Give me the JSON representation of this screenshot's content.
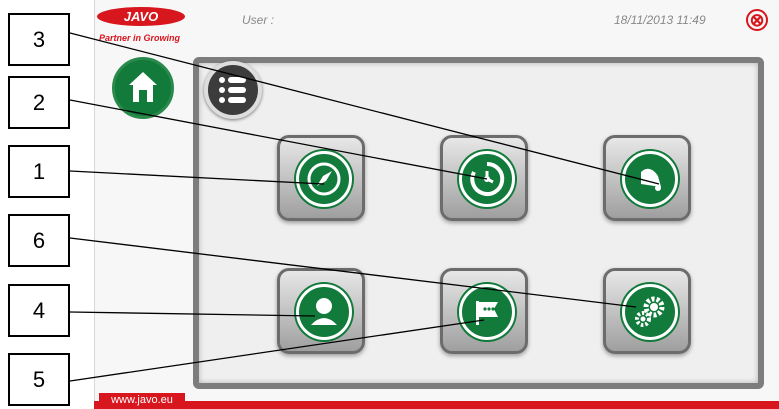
{
  "header": {
    "logo_text": "JAVO",
    "tagline": "Partner in Growing",
    "user_label": "User :",
    "datetime": "18/11/2013  11:49",
    "close_symbol": "⊗"
  },
  "footer": {
    "url": "www.javo.eu"
  },
  "callouts": [
    "3",
    "2",
    "1",
    "6",
    "4",
    "5"
  ],
  "icons": {
    "home": "home-icon",
    "menu": "list-menu-icon",
    "tiles": [
      "compass-icon",
      "timer-icon",
      "alarm-bell-icon",
      "user-icon",
      "flag-icon",
      "settings-gears-icon"
    ]
  },
  "colors": {
    "brand_red": "#d7161e",
    "icon_green": "#127a3b",
    "panel_grey": "#7d7d7d"
  }
}
